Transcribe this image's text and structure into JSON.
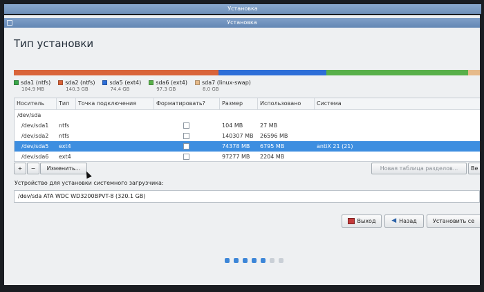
{
  "window": {
    "outer_title": "Установка",
    "inner_title": "Установка"
  },
  "page": {
    "title": "Тип установки"
  },
  "partitions": [
    {
      "name": "sda1 (ntfs)",
      "size": "104.9 MB",
      "color": "#3aa64a",
      "fraction": 0.0003
    },
    {
      "name": "sda2 (ntfs)",
      "size": "140.3 GB",
      "color": "#d9643a",
      "fraction": 0.4384
    },
    {
      "name": "sda5 (ext4)",
      "size": "74.4 GB",
      "color": "#2d6ed8",
      "fraction": 0.2325
    },
    {
      "name": "sda6 (ext4)",
      "size": "97.3 GB",
      "color": "#58b04a",
      "fraction": 0.304
    },
    {
      "name": "sda7 (linux-swap)",
      "size": "8.0 GB",
      "color": "#e6ba8a",
      "fraction": 0.025
    }
  ],
  "table": {
    "columns": [
      "Носитель",
      "Тип",
      "Точка подключения",
      "Форматировать?",
      "Размер",
      "Использовано",
      "Система"
    ],
    "group": "/dev/sda",
    "rows": [
      {
        "device": "/dev/sda1",
        "type": "ntfs",
        "mount": "",
        "format": false,
        "size": "104 MB",
        "used": "27 MB",
        "system": "",
        "selected": false
      },
      {
        "device": "/dev/sda2",
        "type": "ntfs",
        "mount": "",
        "format": false,
        "size": "140307 MB",
        "used": "26596 MB",
        "system": "",
        "selected": false
      },
      {
        "device": "/dev/sda5",
        "type": "ext4",
        "mount": "",
        "format": false,
        "size": "74378 MB",
        "used": "6795 MB",
        "system": "antiX 21 (21)",
        "selected": true
      },
      {
        "device": "/dev/sda6",
        "type": "ext4",
        "mount": "",
        "format": false,
        "size": "97277 MB",
        "used": "2204 MB",
        "system": "",
        "selected": false
      }
    ]
  },
  "toolbar": {
    "add_label": "+",
    "remove_label": "−",
    "change_label": "Изменить...",
    "new_table_label": "Новая таблица разделов...",
    "revert_label": "Ве"
  },
  "bootloader": {
    "label": "Устройство для установки системного загрузчика:",
    "value": "/dev/sda   ATA WDC WD3200BPVT-8 (320.1 GB)"
  },
  "nav": {
    "quit_label": "Выход",
    "back_label": "Назад",
    "install_label": "Установить се"
  },
  "progress": {
    "total_steps": 7,
    "completed_steps": 5,
    "active_color": "#3c86d8",
    "inactive_color": "#c9cfd6"
  }
}
